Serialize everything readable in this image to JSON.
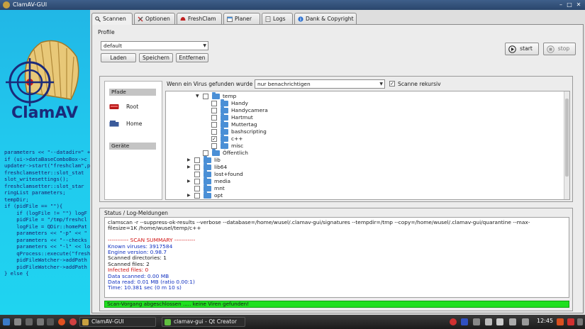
{
  "window": {
    "title": "ClamAV-GUI"
  },
  "tabs": [
    {
      "label": "Scannen",
      "icon": "magnifier-icon",
      "active": true
    },
    {
      "label": "Optionen",
      "icon": "tools-icon"
    },
    {
      "label": "FreshClam",
      "icon": "clam-icon"
    },
    {
      "label": "Planer",
      "icon": "calendar-icon"
    },
    {
      "label": "Logs",
      "icon": "document-icon"
    },
    {
      "label": "Dank & Copyright",
      "icon": "info-icon"
    }
  ],
  "profile": {
    "label": "Profile",
    "selected": "default",
    "load": "Laden",
    "save": "Speichern",
    "remove": "Entfernen"
  },
  "controls": {
    "start": "start",
    "stop": "stop"
  },
  "scan": {
    "virus_label": "Wenn ein Virus gefunden wurde",
    "virus_option": "nur benachrichtigen",
    "recursive_label": "Scanne rekursiv",
    "recursive_checked": true
  },
  "side": {
    "paths_header": "Pfade",
    "root": "Root",
    "home": "Home",
    "devices_header": "Geräte"
  },
  "tree": [
    {
      "name": "temp",
      "indent": 0,
      "expanded": true,
      "checked": false
    },
    {
      "name": "Handy",
      "indent": 1,
      "checked": false
    },
    {
      "name": "Handycamera",
      "indent": 1,
      "checked": false
    },
    {
      "name": "Hartmut",
      "indent": 1,
      "checked": false
    },
    {
      "name": "Muttertag",
      "indent": 1,
      "checked": false
    },
    {
      "name": "bashscripting",
      "indent": 1,
      "checked": false
    },
    {
      "name": "c++",
      "indent": 1,
      "checked": true
    },
    {
      "name": "misc",
      "indent": 1,
      "checked": false
    },
    {
      "name": "Öffentlich",
      "indent": 0,
      "checked": false
    },
    {
      "name": "lib",
      "indent": -1,
      "collapsed": true,
      "checked": false
    },
    {
      "name": "lib64",
      "indent": -1,
      "collapsed": true,
      "checked": false
    },
    {
      "name": "lost+found",
      "indent": -1,
      "checked": false
    },
    {
      "name": "media",
      "indent": -1,
      "collapsed": true,
      "checked": false
    },
    {
      "name": "mnt",
      "indent": -1,
      "checked": false
    },
    {
      "name": "opt",
      "indent": -1,
      "collapsed": true,
      "checked": false
    }
  ],
  "log": {
    "title": "Status / Log-Meldungen",
    "lines": [
      {
        "text": "clamscan  -r --suppress-ok-results --verbose --database=/home/wusel/.clamav-gui/signatures --tempdir=/tmp --copy=/home/wusel/.clamav-gui/quarantine --max-",
        "color": "#1a1a1a"
      },
      {
        "text": "filesize=1K /home/wusel/temp/c++",
        "color": "#1a1a1a"
      },
      {
        "text": "",
        "color": "#1a1a1a"
      },
      {
        "text": "----------- SCAN SUMMARY -----------",
        "color": "#d01010"
      },
      {
        "text": "Known viruses: 3917584",
        "color": "#1030c0"
      },
      {
        "text": "Engine version: 0.98.7",
        "color": "#1030c0"
      },
      {
        "text": "Scanned directories: 1",
        "color": "#1a1a1a"
      },
      {
        "text": "Scanned files: 2",
        "color": "#1a1a1a"
      },
      {
        "text": "Infected files: 0",
        "color": "#d01010"
      },
      {
        "text": "Data scanned: 0.00 MB",
        "color": "#1030c0"
      },
      {
        "text": "Data read: 0.01 MB (ratio 0.00:1)",
        "color": "#1030c0"
      },
      {
        "text": "Time: 10.381 sec (0 m 10 s)",
        "color": "#1030c0"
      }
    ],
    "status": "Scan-Vorgang abgeschlossen ..... keine Viren gefunden!"
  },
  "code": [
    "parameters << \"--datadir=\" +",
    "if (ui->dataBaseComboBox->c",
    "updater->start(\"freshclam\",p",
    "",
    "",
    "freshclamsetter::slot_stat",
    "slot_writesettings();",
    "",
    "",
    "freshclamsetter::slot_star",
    "ringList parameters;",
    "tempDir;",
    "",
    "if (pidFile == \"\"){",
    "    if (logFile != \"\") logF",
    "    pidFile = \"/tmp/freshcl",
    "    logFile = QDir::homePat",
    "    parameters << \"-p\" << \"",
    "    parameters << \"--checks",
    "    parameters << \"-l\" << lo",
    "    qProcess::execute(\"fresh",
    "    pidFileWatcher->addPath",
    "    pidFileWatcher->addPath",
    "} else {"
  ],
  "taskbar": {
    "tasks": [
      {
        "label": "ClamAV-GUI",
        "color": "#c8a040"
      },
      {
        "label": "clamav-gui - Qt Creator",
        "color": "#5fbf3f"
      }
    ],
    "clock": "12:45"
  }
}
